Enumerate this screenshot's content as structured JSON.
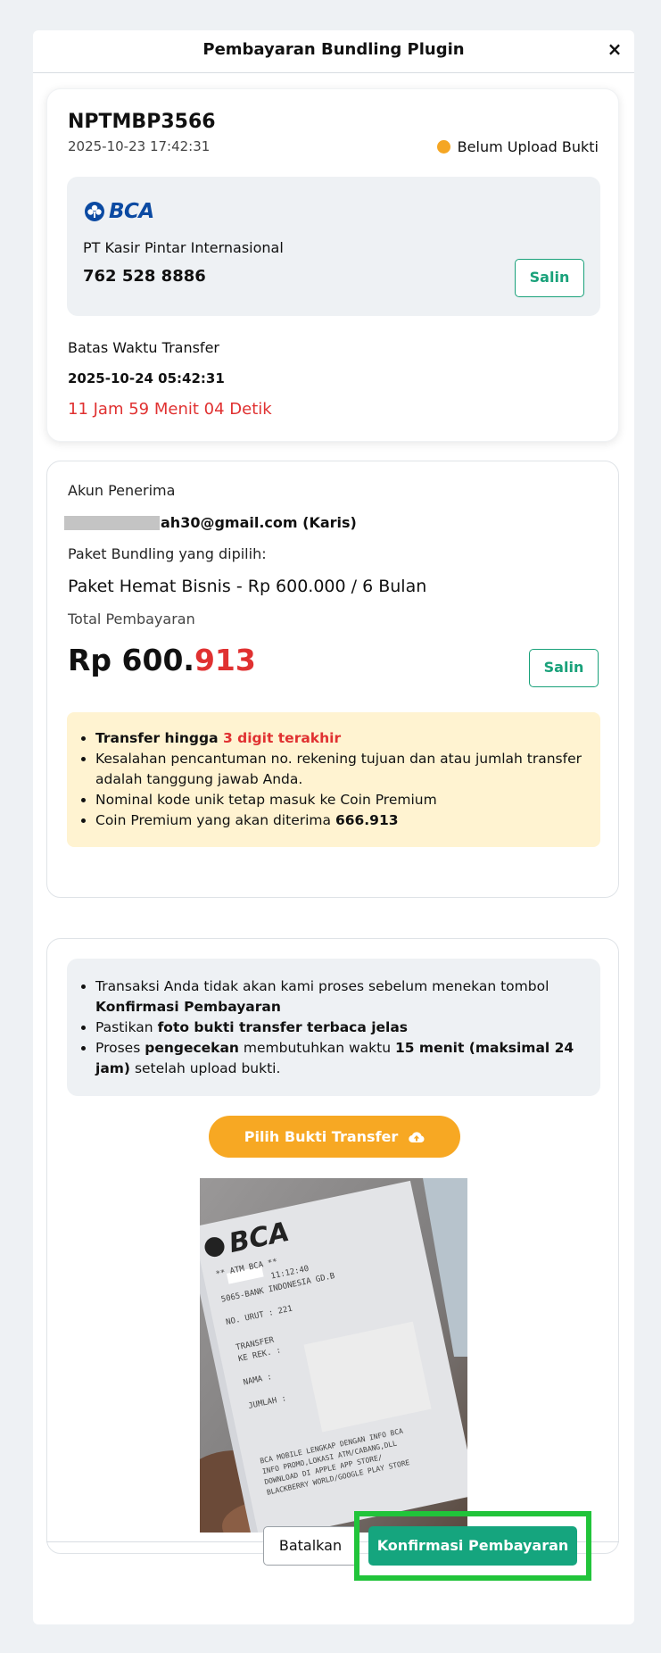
{
  "modal": {
    "title": "Pembayaran Bundling Plugin",
    "close_symbol": "×"
  },
  "order": {
    "id": "NPTMBP3566",
    "date": "2025-10-23 17:42:31",
    "status": "Belum Upload Bukti",
    "status_color": "#f5a623"
  },
  "bank": {
    "name": "BCA",
    "owner": "PT Kasir Pintar Internasional",
    "account_number": "762 528 8886",
    "copy_label": "Salin"
  },
  "deadline": {
    "label": "Batas Waktu Transfer",
    "value": "2025-10-24 05:42:31",
    "countdown": "11 Jam 59 Menit 04 Detik"
  },
  "recipient": {
    "label": "Akun Penerima",
    "email_visible": "ah30@gmail.com (Karis)"
  },
  "package": {
    "label": "Paket Bundling yang dipilih:",
    "value": "Paket Hemat Bisnis - Rp 600.000 / 6 Bulan"
  },
  "total": {
    "label": "Total Pembayaran",
    "amount_prefix": "Rp 600.",
    "amount_suffix": "913",
    "copy_label": "Salin"
  },
  "notes": {
    "n1_a": "Transfer hingga ",
    "n1_b": "3 digit terakhir",
    "n2": "Kesalahan pencantuman no. rekening tujuan dan atau jumlah transfer adalah tanggung jawab Anda.",
    "n3": "Nominal kode unik tetap masuk ke Coin Premium",
    "n4_a": "Coin Premium yang akan diterima ",
    "n4_b": "666.913"
  },
  "info": {
    "i1_a": "Transaksi Anda tidak akan kami proses sebelum menekan tombol ",
    "i1_b": "Konfirmasi Pembayaran",
    "i2_a": "Pastikan ",
    "i2_b": "foto bukti transfer terbaca jelas",
    "i3_a": "Proses ",
    "i3_b": "pengecekan",
    "i3_c": " membutuhkan waktu ",
    "i3_d": "15 menit (maksimal 24 jam)",
    "i3_e": " setelah upload bukti."
  },
  "upload": {
    "label": "Pilih Bukti Transfer"
  },
  "receipt": {
    "brand": "BCA",
    "l1": "**  ATM BCA  **",
    "l2": "11:12:40",
    "l3": "5065-BANK INDONESIA GD.B",
    "l4": "NO. URUT : 221",
    "l5": "TRANSFER",
    "l6": "KE REK.  :",
    "l7": "NAMA     :",
    "l8": "JUMLAH   :",
    "l9": "BCA MOBILE LENGKAP DENGAN INFO BCA",
    "l10": "INFO PROMO,LOKASI ATM/CABANG,DLL",
    "l11": "DOWNLOAD DI APPLE APP STORE/",
    "l12": "BLACKBERRY WORLD/GOOGLE PLAY STORE"
  },
  "footer": {
    "cancel_label": "Batalkan",
    "confirm_label": "Konfirmasi Pembayaran",
    "highlight_color": "#21c43a"
  },
  "colors": {
    "accent_green": "#15a57e",
    "warning_orange": "#f7a823",
    "danger_red": "#e03131",
    "bca_blue": "#0b4aa2"
  }
}
